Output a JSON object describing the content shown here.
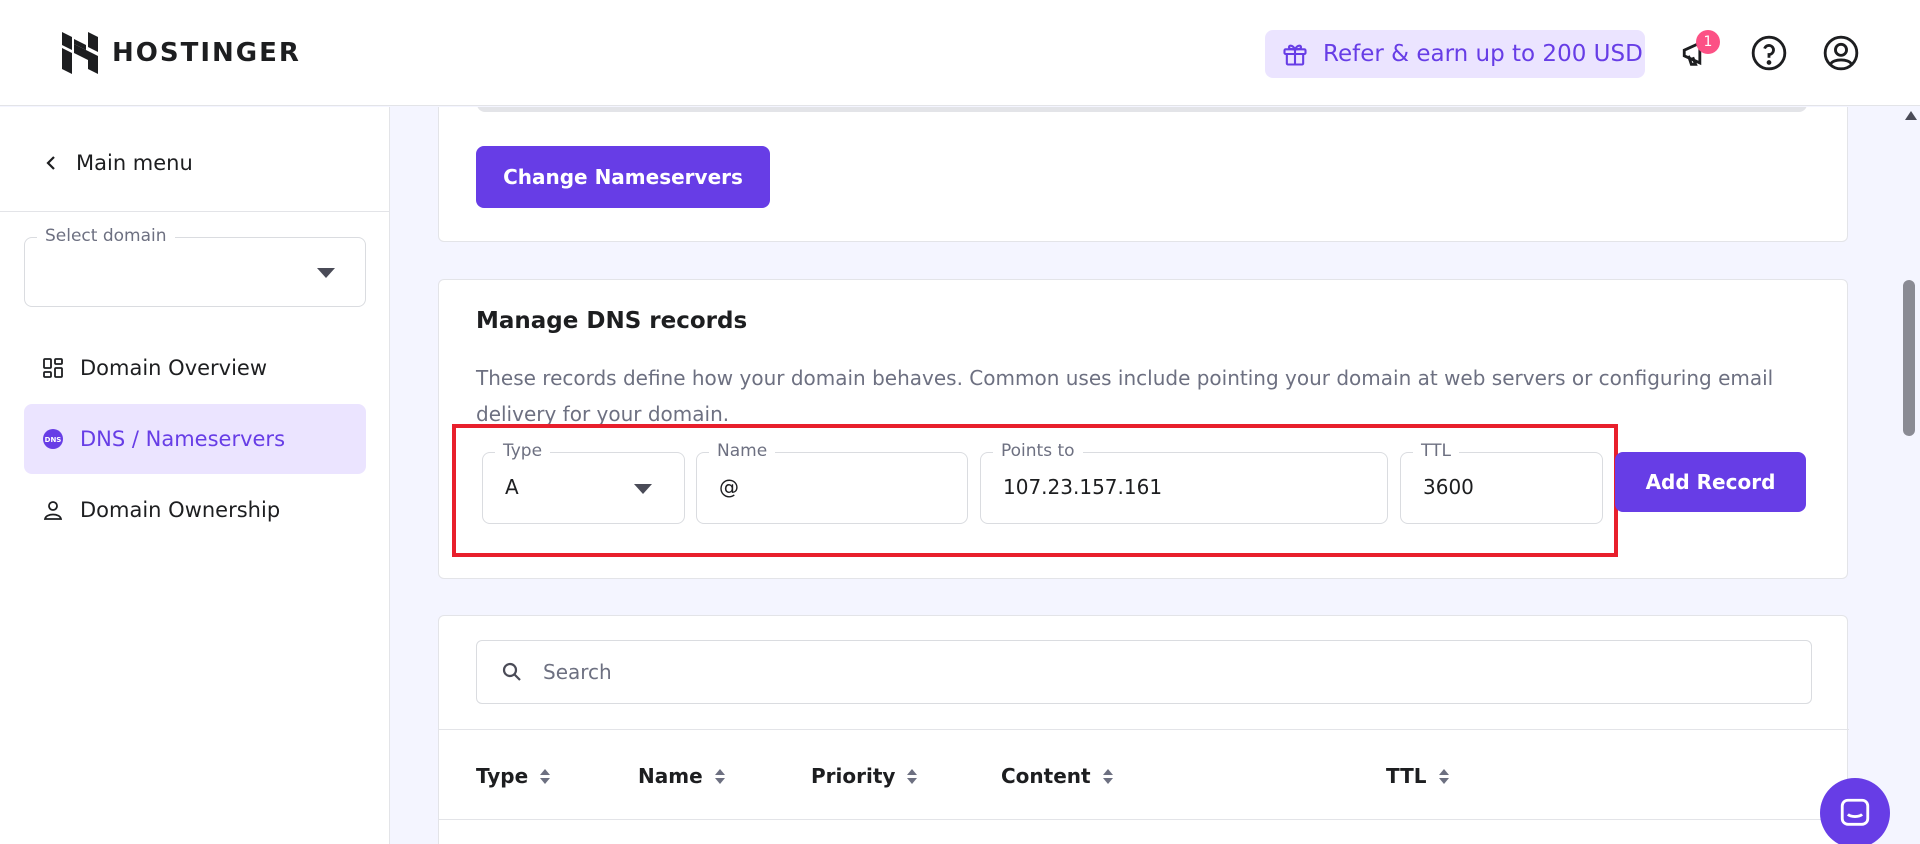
{
  "brand": {
    "name": "HOSTINGER"
  },
  "header": {
    "refer_label": "Refer & earn up to 200 USD",
    "notification_count": "1"
  },
  "sidebar": {
    "main_menu": "Main menu",
    "select_domain": {
      "label": "Select domain",
      "value": ""
    },
    "items": [
      {
        "label": "Domain Overview",
        "icon": "grid-icon",
        "active": false
      },
      {
        "label": "DNS / Nameservers",
        "icon": "dns-icon",
        "active": true
      },
      {
        "label": "Domain Ownership",
        "icon": "person-icon",
        "active": false
      }
    ]
  },
  "nameservers": {
    "change_button": "Change Nameservers"
  },
  "dns": {
    "title": "Manage DNS records",
    "description": "These records define how your domain behaves. Common uses include pointing your domain at web servers or configuring email delivery for your domain.",
    "form": {
      "type": {
        "label": "Type",
        "value": "A"
      },
      "name": {
        "label": "Name",
        "value": "@"
      },
      "points_to": {
        "label": "Points to",
        "value": "107.23.157.161"
      },
      "ttl": {
        "label": "TTL",
        "value": "3600"
      }
    },
    "add_button": "Add Record"
  },
  "records": {
    "search_placeholder": "Search",
    "columns": [
      "Type",
      "Name",
      "Priority",
      "Content",
      "TTL"
    ]
  },
  "colors": {
    "accent": "#673de6",
    "accent_light": "#ebe4ff",
    "highlight": "#e81f2c",
    "badge": "#fc5185"
  }
}
